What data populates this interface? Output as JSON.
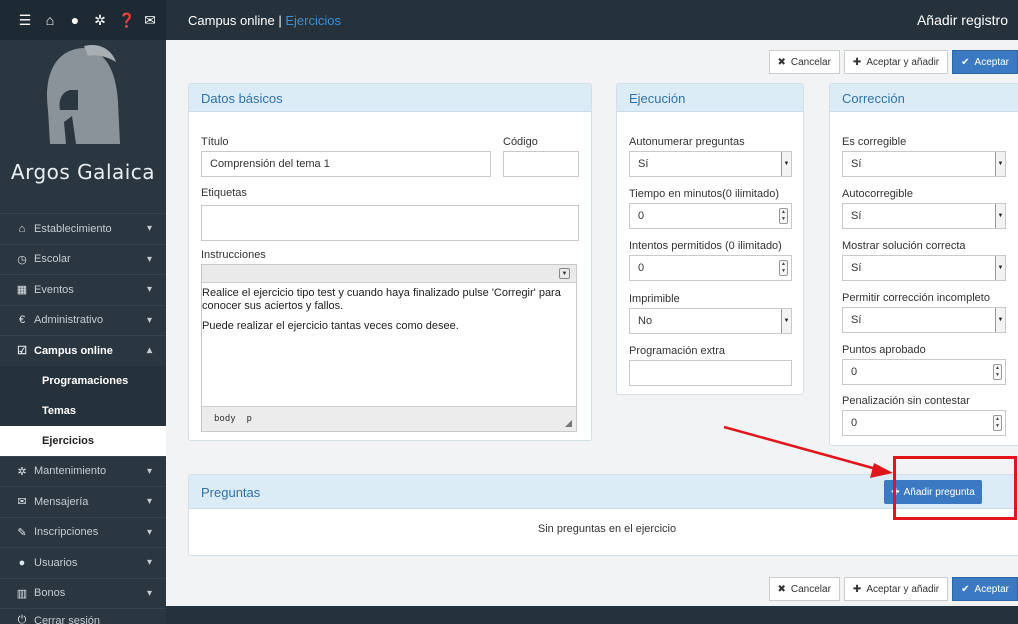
{
  "topbar": {
    "app": "Campus online",
    "sep": " | ",
    "crumb": "Ejercicios",
    "right": "Añadir registro"
  },
  "sidebar": {
    "logo_text": "Argos Galaica",
    "items": [
      {
        "label": "Establecimiento",
        "icon": "home-icon"
      },
      {
        "label": "Escolar",
        "icon": "clock-icon"
      },
      {
        "label": "Eventos",
        "icon": "calendar-icon"
      },
      {
        "label": "Administrativo",
        "icon": "euro-icon"
      },
      {
        "label": "Campus online",
        "icon": "checkbox-icon"
      },
      {
        "label": "Programaciones"
      },
      {
        "label": "Temas"
      },
      {
        "label": "Ejercicios"
      },
      {
        "label": "Mantenimiento",
        "icon": "cog-icon"
      },
      {
        "label": "Mensajería",
        "icon": "envelope-icon"
      },
      {
        "label": "Inscripciones",
        "icon": "pencil-icon"
      },
      {
        "label": "Usuarios",
        "icon": "user-icon"
      },
      {
        "label": "Bonos",
        "icon": "barcode-icon"
      },
      {
        "label": "Cerrar sesión",
        "icon": "power-icon"
      }
    ]
  },
  "actions": {
    "cancel": "Cancelar",
    "accept_add": "Aceptar y añadir",
    "accept": "Aceptar"
  },
  "datos": {
    "title": "Datos básicos",
    "titulo_label": "Título",
    "titulo_value": "Comprensión del tema 1",
    "codigo_label": "Código",
    "codigo_value": "",
    "etiquetas_label": "Etiquetas",
    "etiquetas_value": "",
    "instrucciones_label": "Instrucciones",
    "instrucciones_p1": "Realice el ejercicio tipo test y cuando haya finalizado pulse 'Corregir' para conocer sus aciertos y fallos.",
    "instrucciones_p2": "Puede realizar el ejercicio tantas veces como desee.",
    "status": "body  p"
  },
  "ejecucion": {
    "title": "Ejecución",
    "autonumerar_label": "Autonumerar preguntas",
    "autonumerar_value": "Sí",
    "tiempo_label": "Tiempo en minutos(0 ilimitado)",
    "tiempo_value": "0",
    "intentos_label": "Intentos permitidos (0 ilimitado)",
    "intentos_value": "0",
    "imprimible_label": "Imprimible",
    "imprimible_value": "No",
    "programacion_label": "Programación extra",
    "programacion_value": ""
  },
  "correccion": {
    "title": "Corrección",
    "corregible_label": "Es corregible",
    "corregible_value": "Sí",
    "autocorregible_label": "Autocorregible",
    "autocorregible_value": "Sí",
    "mostrar_label": "Mostrar solución correcta",
    "mostrar_value": "Sí",
    "incompleto_label": "Permitir corrección incompleto",
    "incompleto_value": "Sí",
    "puntos_label": "Puntos aprobado",
    "puntos_value": "0",
    "penalizacion_label": "Penalización sin contestar",
    "penalizacion_value": "0"
  },
  "preguntas": {
    "title": "Preguntas",
    "add_label": "Añadir pregunta",
    "empty": "Sin preguntas en el ejercicio"
  },
  "colors": {
    "primary": "#3b7ac2",
    "sidebar": "#2a3640",
    "panel_head": "#dcecf6",
    "annotation": "#e0161c"
  }
}
